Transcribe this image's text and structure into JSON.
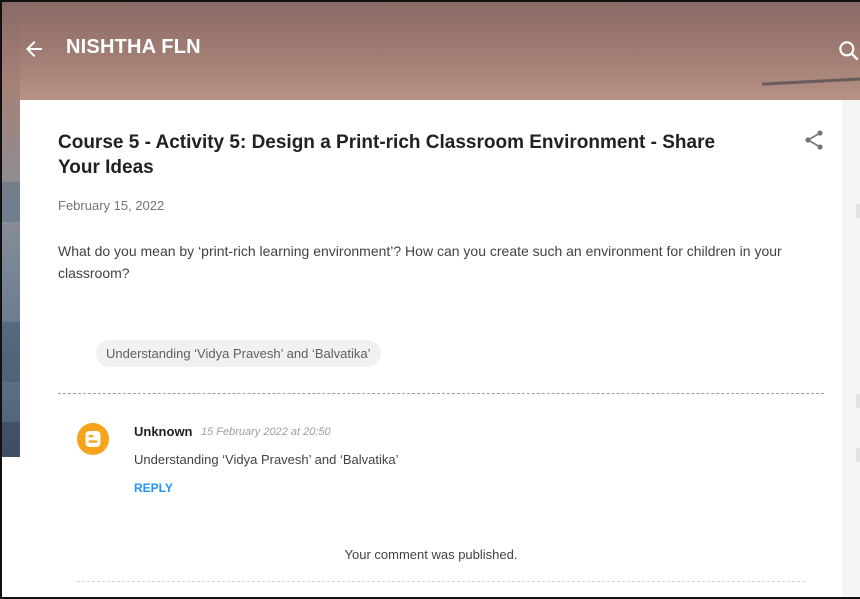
{
  "header": {
    "blog_title": "NISHTHA FLN",
    "back_icon": "arrow-left-icon",
    "search_icon": "search-icon"
  },
  "post": {
    "title": "Course 5 - Activity 5: Design a Print-rich Classroom Environment - Share Your Ideas",
    "date": "February 15, 2022",
    "body": "What do you mean by ‘print-rich learning environment’? How can you create such an environment for children in your classroom?",
    "label": "Understanding ‘Vidya Pravesh’ and ‘Balvatika’",
    "share_icon": "share-icon"
  },
  "comment": {
    "author": "Unknown",
    "timestamp": "15 February 2022 at 20:50",
    "text": "Understanding ‘Vidya Pravesh’ and ‘Balvatika’",
    "reply_label": "REPLY",
    "avatar_icon": "blogger-icon"
  },
  "status": {
    "published_message": "Your comment was published."
  },
  "colors": {
    "accent": "#2196f3",
    "avatar": "#f9a21b",
    "title_text": "#212121"
  }
}
